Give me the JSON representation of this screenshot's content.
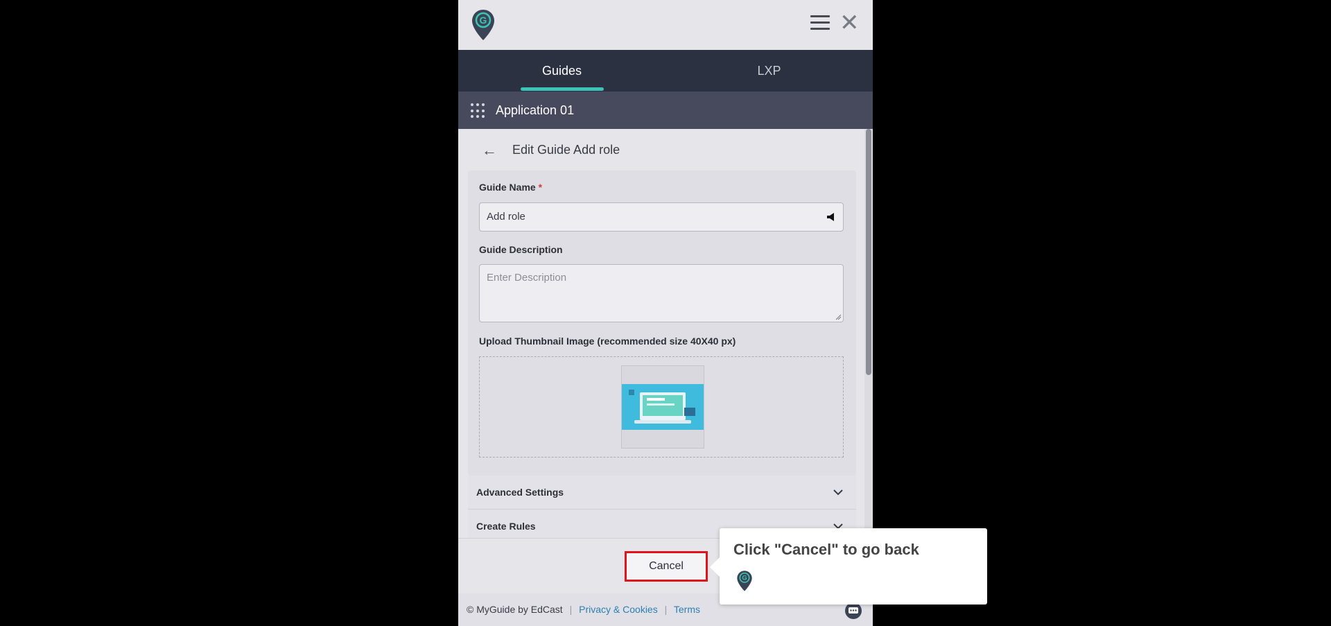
{
  "header": {
    "logo_icon": "myguide-logo-icon",
    "menu_icon": "hamburger-menu-icon",
    "close_icon": "close-icon"
  },
  "tabs": [
    {
      "label": "Guides",
      "active": true
    },
    {
      "label": "LXP",
      "active": false
    }
  ],
  "app": {
    "name": "Application 01",
    "icon": "apps-grid-icon"
  },
  "page": {
    "title": "Edit Guide Add role",
    "back_icon": "back-arrow-icon"
  },
  "form": {
    "guide_name": {
      "label": "Guide Name",
      "required_mark": "*",
      "value": "Add role"
    },
    "guide_description": {
      "label": "Guide Description",
      "placeholder": "Enter Description",
      "value": ""
    },
    "thumbnail": {
      "label": "Upload Thumbnail Image (recommended size 40X40 px)"
    }
  },
  "sections": [
    {
      "label": "Advanced Settings"
    },
    {
      "label": "Create Rules"
    }
  ],
  "actions": {
    "cancel_label": "Cancel"
  },
  "footer": {
    "copyright": "© MyGuide by EdCast",
    "privacy_link": "Privacy & Cookies",
    "separator": "|",
    "terms_link": "Terms"
  },
  "tooltip": {
    "text": "Click \"Cancel\" to go back"
  },
  "colors": {
    "accent": "#3cc4b4",
    "tab_bar": "#2b3140",
    "app_bar": "#464a5c",
    "highlight": "#e0141b",
    "link": "#2e7fb0"
  }
}
